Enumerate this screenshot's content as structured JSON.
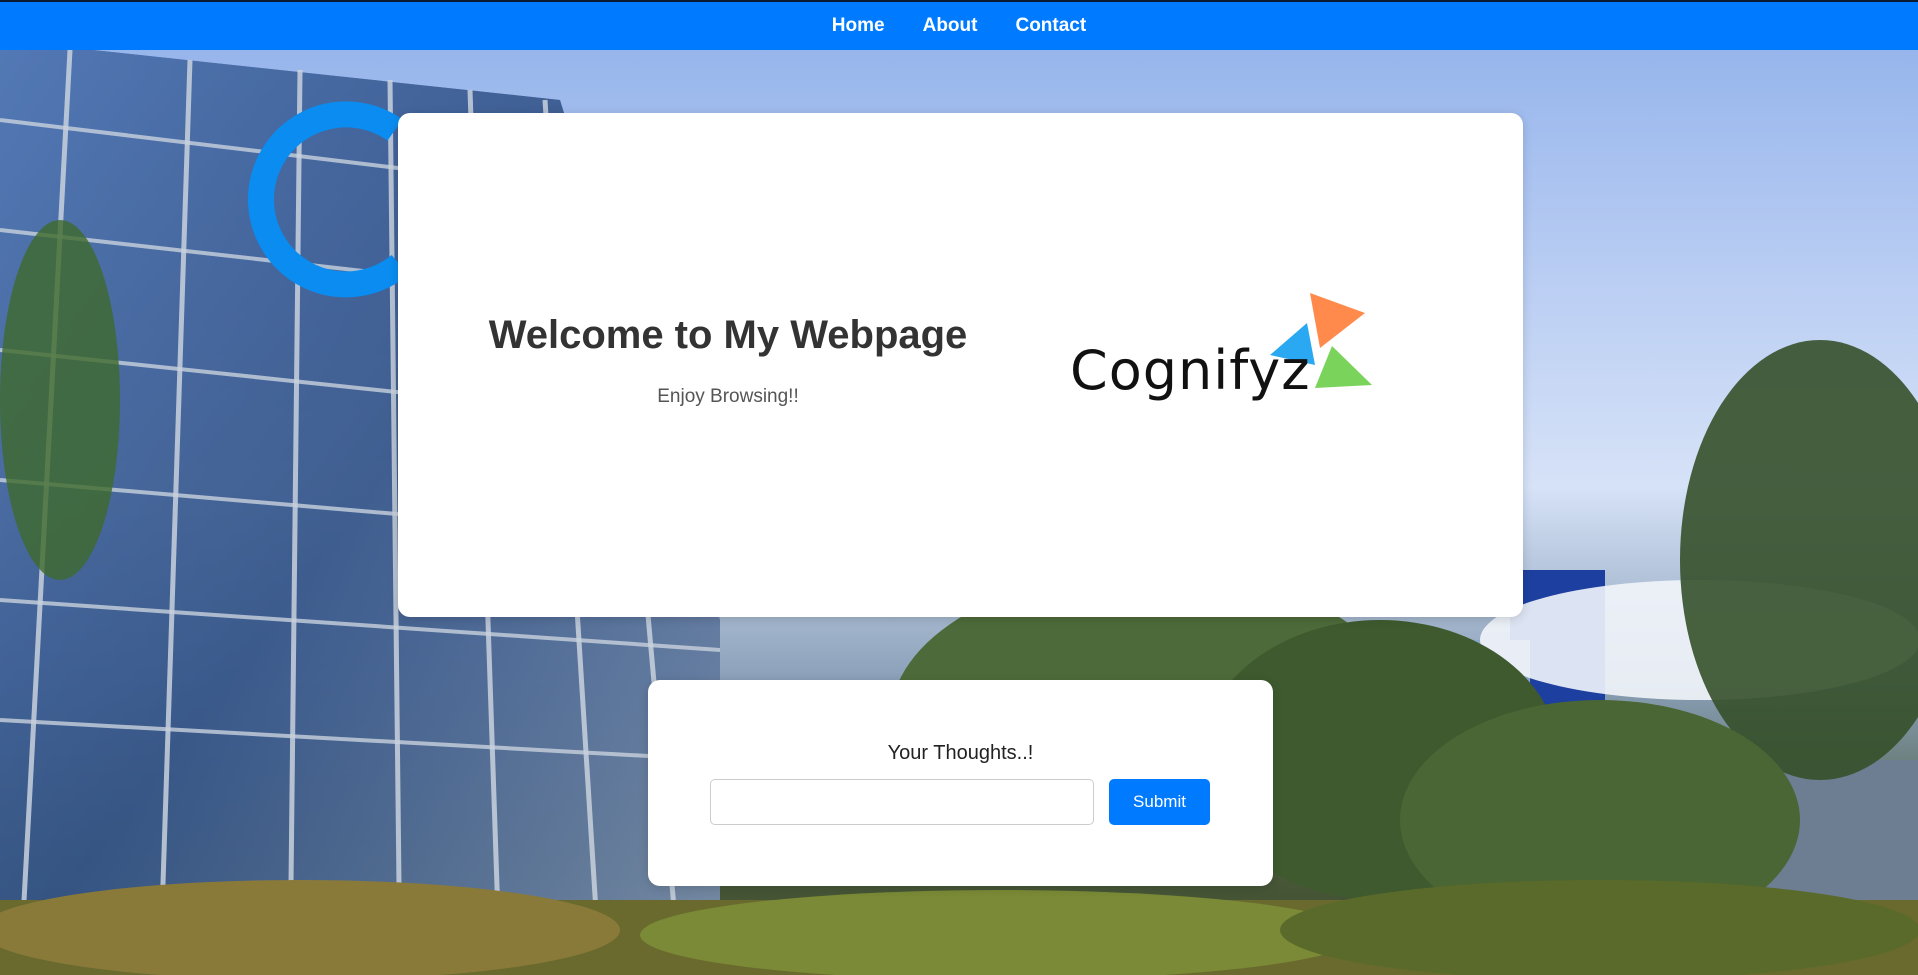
{
  "nav": {
    "items": [
      {
        "label": "Home"
      },
      {
        "label": "About"
      },
      {
        "label": "Contact"
      }
    ]
  },
  "hero": {
    "title": "Welcome to My Webpage",
    "subtitle": "Enjoy Browsing!!",
    "logo_text": "Cognifyz"
  },
  "thoughts": {
    "label": "Your Thoughts..!",
    "input_value": "",
    "input_placeholder": "",
    "submit_label": "Submit"
  },
  "colors": {
    "accent": "#007bff",
    "logo_orange": "#ff8a4c",
    "logo_blue": "#2aa8f2",
    "logo_green": "#7ad35a"
  }
}
